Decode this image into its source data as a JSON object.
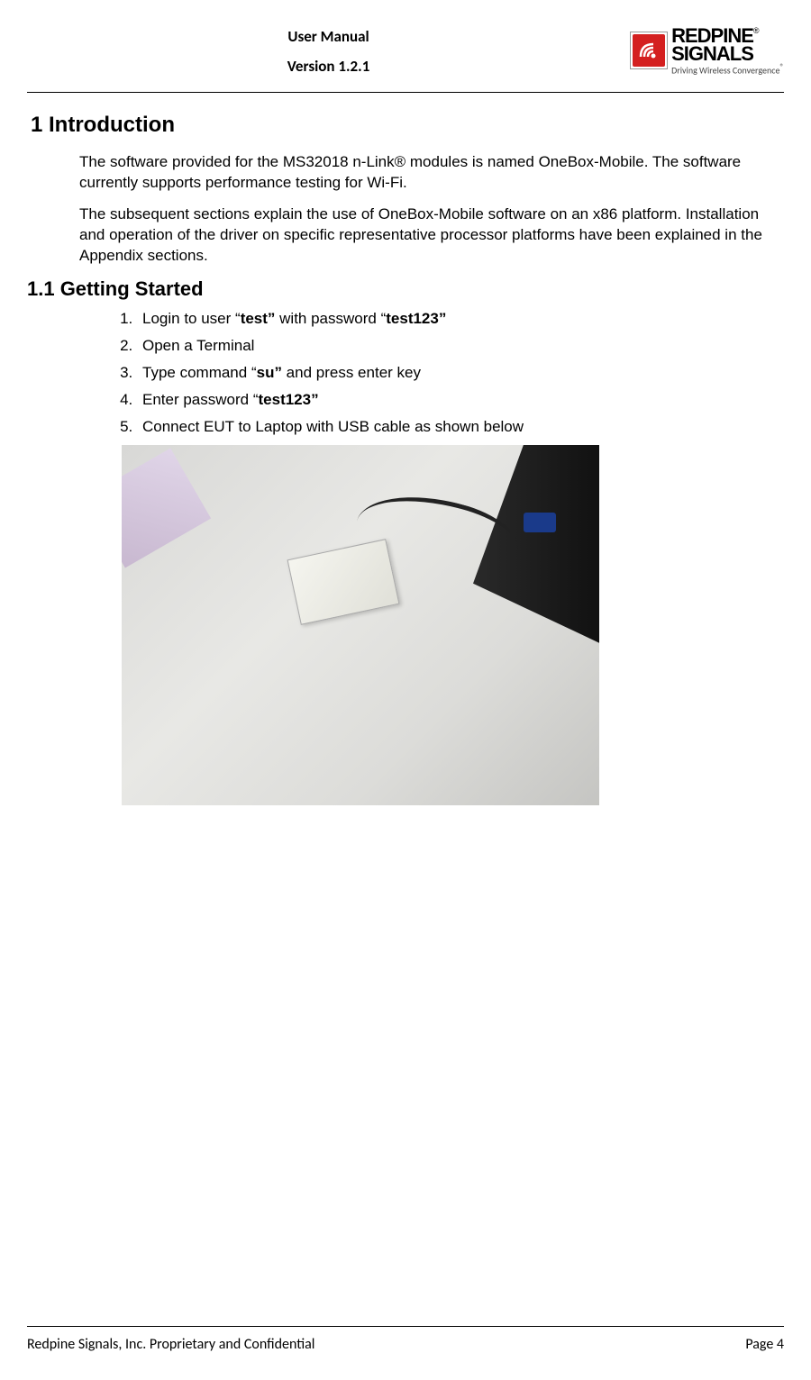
{
  "header": {
    "title": "User Manual",
    "version": "Version 1.2.1"
  },
  "logo": {
    "brand_line1": "REDPINE",
    "brand_line2": "SIGNALS",
    "tagline": "Driving Wireless Convergence",
    "reg": "®"
  },
  "section": {
    "number_title": "1  Introduction",
    "para1": "The software provided for the MS32018 n-Link® modules is named OneBox-Mobile. The software currently supports performance testing for Wi-Fi.",
    "para2": "The subsequent sections explain the use of OneBox-Mobile software on an x86 platform. Installation and operation of the driver on specific representative processor platforms have been explained in the Appendix sections."
  },
  "subsection": {
    "number_title": "1.1  Getting Started",
    "steps": [
      {
        "pre": "Login to user “",
        "bold": "test”",
        "mid": " with password “",
        "bold2": "test123”",
        "post": ""
      },
      {
        "pre": "Open a Terminal",
        "bold": "",
        "mid": "",
        "bold2": "",
        "post": ""
      },
      {
        "pre": "Type command “",
        "bold": "su”",
        "mid": " and press enter key",
        "bold2": "",
        "post": ""
      },
      {
        "pre": "Enter password “",
        "bold": "test123”",
        "mid": "",
        "bold2": "",
        "post": ""
      },
      {
        "pre": "Connect EUT to Laptop with USB cable as shown below",
        "bold": "",
        "mid": "",
        "bold2": "",
        "post": ""
      }
    ]
  },
  "footer": {
    "left": "Redpine Signals, Inc. Proprietary and Confidential",
    "right": "Page 4"
  }
}
